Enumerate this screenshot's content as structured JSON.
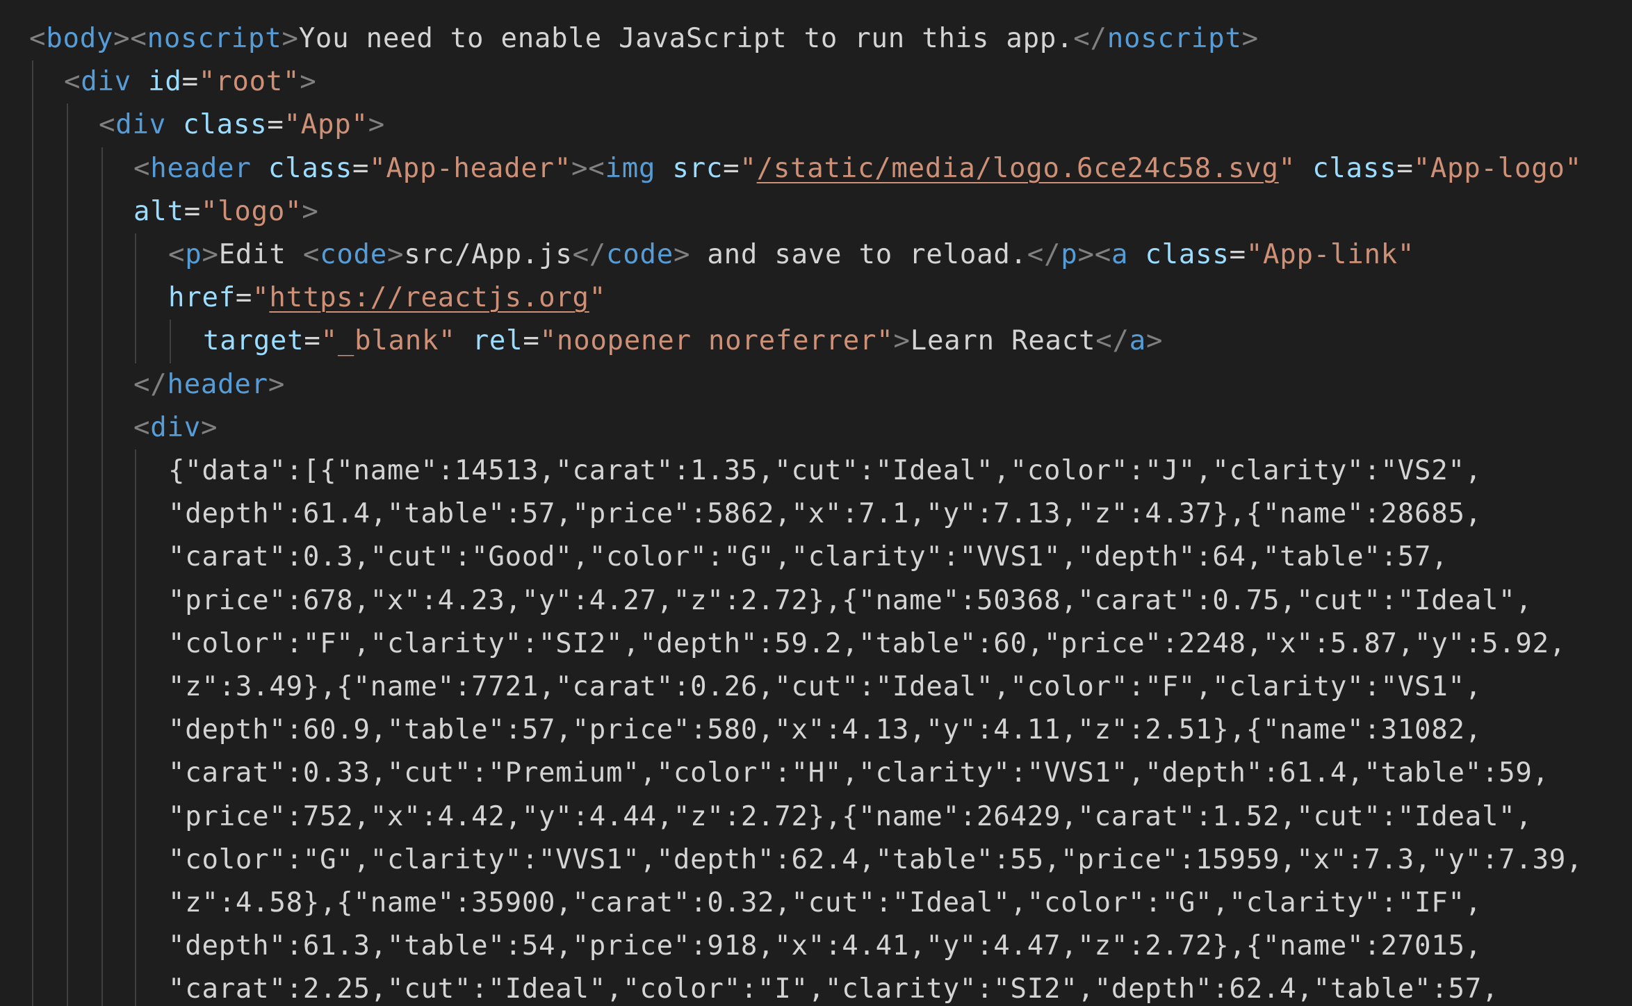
{
  "editor": {
    "theme_colors": {
      "background": "#1e1e1e",
      "punctuation": "#808080",
      "tag": "#569cd6",
      "attribute": "#9cdcfe",
      "string": "#ce9178",
      "text": "#d4d4d4",
      "indent_guide": "#404040"
    },
    "lines": [
      {
        "indent": 0,
        "tokens": [
          {
            "c": "p",
            "t": "<"
          },
          {
            "c": "n",
            "t": "body"
          },
          {
            "c": "p",
            "t": ">"
          },
          {
            "c": "p",
            "t": "<"
          },
          {
            "c": "n",
            "t": "noscript"
          },
          {
            "c": "p",
            "t": ">"
          },
          {
            "c": "x",
            "t": "You need to enable JavaScript to run this app."
          },
          {
            "c": "p",
            "t": "</"
          },
          {
            "c": "n",
            "t": "noscript"
          },
          {
            "c": "p",
            "t": ">"
          }
        ]
      },
      {
        "indent": 1,
        "tokens": [
          {
            "c": "p",
            "t": "<"
          },
          {
            "c": "n",
            "t": "div"
          },
          {
            "c": "x",
            "t": " "
          },
          {
            "c": "a",
            "t": "id"
          },
          {
            "c": "x",
            "t": "="
          },
          {
            "c": "v",
            "t": "\"root\""
          },
          {
            "c": "p",
            "t": ">"
          }
        ]
      },
      {
        "indent": 2,
        "tokens": [
          {
            "c": "p",
            "t": "<"
          },
          {
            "c": "n",
            "t": "div"
          },
          {
            "c": "x",
            "t": " "
          },
          {
            "c": "a",
            "t": "class"
          },
          {
            "c": "x",
            "t": "="
          },
          {
            "c": "v",
            "t": "\"App\""
          },
          {
            "c": "p",
            "t": ">"
          }
        ]
      },
      {
        "indent": 3,
        "tokens": [
          {
            "c": "p",
            "t": "<"
          },
          {
            "c": "n",
            "t": "header"
          },
          {
            "c": "x",
            "t": " "
          },
          {
            "c": "a",
            "t": "class"
          },
          {
            "c": "x",
            "t": "="
          },
          {
            "c": "v",
            "t": "\"App-header\""
          },
          {
            "c": "p",
            "t": ">"
          },
          {
            "c": "p",
            "t": "<"
          },
          {
            "c": "n",
            "t": "img"
          },
          {
            "c": "x",
            "t": " "
          },
          {
            "c": "a",
            "t": "src"
          },
          {
            "c": "x",
            "t": "="
          },
          {
            "c": "v",
            "t": "\""
          },
          {
            "c": "u",
            "t": "/static/media/logo.6ce24c58.svg"
          },
          {
            "c": "v",
            "t": "\""
          },
          {
            "c": "x",
            "t": " "
          },
          {
            "c": "a",
            "t": "class"
          },
          {
            "c": "x",
            "t": "="
          },
          {
            "c": "v",
            "t": "\"App-logo\""
          }
        ]
      },
      {
        "indent": 3,
        "tokens": [
          {
            "c": "a",
            "t": "alt"
          },
          {
            "c": "x",
            "t": "="
          },
          {
            "c": "v",
            "t": "\"logo\""
          },
          {
            "c": "p",
            "t": ">"
          }
        ]
      },
      {
        "indent": 4,
        "tokens": [
          {
            "c": "p",
            "t": "<"
          },
          {
            "c": "n",
            "t": "p"
          },
          {
            "c": "p",
            "t": ">"
          },
          {
            "c": "x",
            "t": "Edit "
          },
          {
            "c": "p",
            "t": "<"
          },
          {
            "c": "n",
            "t": "code"
          },
          {
            "c": "p",
            "t": ">"
          },
          {
            "c": "x",
            "t": "src/App.js"
          },
          {
            "c": "p",
            "t": "</"
          },
          {
            "c": "n",
            "t": "code"
          },
          {
            "c": "p",
            "t": ">"
          },
          {
            "c": "x",
            "t": " and save to reload."
          },
          {
            "c": "p",
            "t": "</"
          },
          {
            "c": "n",
            "t": "p"
          },
          {
            "c": "p",
            "t": ">"
          },
          {
            "c": "p",
            "t": "<"
          },
          {
            "c": "n",
            "t": "a"
          },
          {
            "c": "x",
            "t": " "
          },
          {
            "c": "a",
            "t": "class"
          },
          {
            "c": "x",
            "t": "="
          },
          {
            "c": "v",
            "t": "\"App-link\""
          }
        ]
      },
      {
        "indent": 4,
        "tokens": [
          {
            "c": "a",
            "t": "href"
          },
          {
            "c": "x",
            "t": "="
          },
          {
            "c": "v",
            "t": "\""
          },
          {
            "c": "u",
            "t": "https://reactjs.org"
          },
          {
            "c": "v",
            "t": "\""
          }
        ]
      },
      {
        "indent": 5,
        "tokens": [
          {
            "c": "a",
            "t": "target"
          },
          {
            "c": "x",
            "t": "="
          },
          {
            "c": "v",
            "t": "\"_blank\""
          },
          {
            "c": "x",
            "t": " "
          },
          {
            "c": "a",
            "t": "rel"
          },
          {
            "c": "x",
            "t": "="
          },
          {
            "c": "v",
            "t": "\"noopener noreferrer\""
          },
          {
            "c": "p",
            "t": ">"
          },
          {
            "c": "x",
            "t": "Learn React"
          },
          {
            "c": "p",
            "t": "</"
          },
          {
            "c": "n",
            "t": "a"
          },
          {
            "c": "p",
            "t": ">"
          }
        ]
      },
      {
        "indent": 3,
        "tokens": [
          {
            "c": "p",
            "t": "</"
          },
          {
            "c": "n",
            "t": "header"
          },
          {
            "c": "p",
            "t": ">"
          }
        ]
      },
      {
        "indent": 3,
        "tokens": [
          {
            "c": "p",
            "t": "<"
          },
          {
            "c": "n",
            "t": "div"
          },
          {
            "c": "p",
            "t": ">"
          }
        ]
      },
      {
        "indent": 4,
        "tokens": [
          {
            "c": "x",
            "t": "{\"data\":[{\"name\":14513,\"carat\":1.35,\"cut\":\"Ideal\",\"color\":\"J\",\"clarity\":\"VS2\","
          }
        ]
      },
      {
        "indent": 4,
        "tokens": [
          {
            "c": "x",
            "t": "\"depth\":61.4,\"table\":57,\"price\":5862,\"x\":7.1,\"y\":7.13,\"z\":4.37},{\"name\":28685,"
          }
        ]
      },
      {
        "indent": 4,
        "tokens": [
          {
            "c": "x",
            "t": "\"carat\":0.3,\"cut\":\"Good\",\"color\":\"G\",\"clarity\":\"VVS1\",\"depth\":64,\"table\":57,"
          }
        ]
      },
      {
        "indent": 4,
        "tokens": [
          {
            "c": "x",
            "t": "\"price\":678,\"x\":4.23,\"y\":4.27,\"z\":2.72},{\"name\":50368,\"carat\":0.75,\"cut\":\"Ideal\","
          }
        ]
      },
      {
        "indent": 4,
        "tokens": [
          {
            "c": "x",
            "t": "\"color\":\"F\",\"clarity\":\"SI2\",\"depth\":59.2,\"table\":60,\"price\":2248,\"x\":5.87,\"y\":5.92,"
          }
        ]
      },
      {
        "indent": 4,
        "tokens": [
          {
            "c": "x",
            "t": "\"z\":3.49},{\"name\":7721,\"carat\":0.26,\"cut\":\"Ideal\",\"color\":\"F\",\"clarity\":\"VS1\","
          }
        ]
      },
      {
        "indent": 4,
        "tokens": [
          {
            "c": "x",
            "t": "\"depth\":60.9,\"table\":57,\"price\":580,\"x\":4.13,\"y\":4.11,\"z\":2.51},{\"name\":31082,"
          }
        ]
      },
      {
        "indent": 4,
        "tokens": [
          {
            "c": "x",
            "t": "\"carat\":0.33,\"cut\":\"Premium\",\"color\":\"H\",\"clarity\":\"VVS1\",\"depth\":61.4,\"table\":59,"
          }
        ]
      },
      {
        "indent": 4,
        "tokens": [
          {
            "c": "x",
            "t": "\"price\":752,\"x\":4.42,\"y\":4.44,\"z\":2.72},{\"name\":26429,\"carat\":1.52,\"cut\":\"Ideal\","
          }
        ]
      },
      {
        "indent": 4,
        "tokens": [
          {
            "c": "x",
            "t": "\"color\":\"G\",\"clarity\":\"VVS1\",\"depth\":62.4,\"table\":55,\"price\":15959,\"x\":7.3,\"y\":7.39,"
          }
        ]
      },
      {
        "indent": 4,
        "tokens": [
          {
            "c": "x",
            "t": "\"z\":4.58},{\"name\":35900,\"carat\":0.32,\"cut\":\"Ideal\",\"color\":\"G\",\"clarity\":\"IF\","
          }
        ]
      },
      {
        "indent": 4,
        "tokens": [
          {
            "c": "x",
            "t": "\"depth\":61.3,\"table\":54,\"price\":918,\"x\":4.41,\"y\":4.47,\"z\":2.72},{\"name\":27015,"
          }
        ]
      },
      {
        "indent": 4,
        "tokens": [
          {
            "c": "x",
            "t": "\"carat\":2.25,\"cut\":\"Ideal\",\"color\":\"I\",\"clarity\":\"SI2\",\"depth\":62.4,\"table\":57,"
          }
        ]
      }
    ]
  }
}
